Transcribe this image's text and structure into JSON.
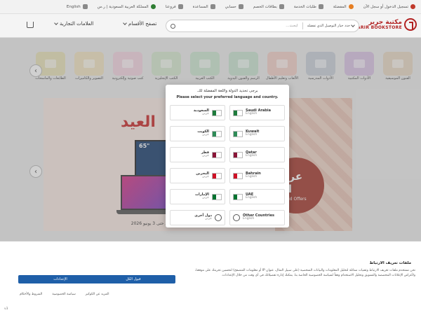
{
  "topbar": {
    "language": "English",
    "country": "المملكة العربية السعودية | ر.س",
    "wishlist": "المفضلة",
    "account": "تسجيل الدخول أو سجل الآن",
    "items": [
      "المفضلة",
      "طلبات الخدمة",
      "بطاقات الخصم",
      "حسابي",
      "المساعدة",
      "فروعنا"
    ]
  },
  "header": {
    "logo_ar": "مكتبة جرير",
    "logo_en": "JARIR BOOKSTORE",
    "search_location": "حدد خيار التوصيل الذي تفضله",
    "search_placeholder": "ابحث...",
    "browse_label": "تصفح الأقسام",
    "brands_label": "العلامات التجارية"
  },
  "categories": [
    {
      "label": "الفنون الموسيقية",
      "color": "#e9d9c5"
    },
    {
      "label": "الأدوات المكتبية",
      "color": "#d9c4e3"
    },
    {
      "label": "الأدوات المدرسية",
      "color": "#c9cfd9"
    },
    {
      "label": "الألعاب وتعليم الأطفال",
      "color": "#f2cfc8"
    },
    {
      "label": "الرسم والفنون اليدوية",
      "color": "#c9e3d1"
    },
    {
      "label": "الكتب العربية",
      "color": "#cde6d2"
    },
    {
      "label": "الكتب الإنجليزية",
      "color": "#d6e9cf"
    },
    {
      "label": "كتب صوتية وإلكترونية",
      "color": "#f3d4e0"
    },
    {
      "label": "التصوير والكاميرات",
      "color": "#f1e3c2"
    },
    {
      "label": "الطابعات والماسحات",
      "color": "#e8e2b8"
    }
  ],
  "banner": {
    "headline_ar": "العيد",
    "badge_ar": "عروض العيد",
    "badge_en": "Eid Offers",
    "tv_text": "65\"",
    "caption": "*يسري العرض على أصناف مختارة فقط *تسري العروض حتى 3 يونيو 2026"
  },
  "modal": {
    "title_ar": "برجى تحديد الدولة واللغة المفضلة لك.",
    "title_en": "Please select your preferred language and country.",
    "options": [
      {
        "name": "السعودية",
        "lang": "عربي",
        "dir": "rtl",
        "flag": "#1e7b3c"
      },
      {
        "name": "Saudi Arabia",
        "lang": "English",
        "dir": "ltr",
        "flag": "#1e7b3c"
      },
      {
        "name": "الكويت",
        "lang": "عربي",
        "dir": "rtl",
        "flag": "#2e8b57"
      },
      {
        "name": "Kuwait",
        "lang": "English",
        "dir": "ltr",
        "flag": "#2e8b57"
      },
      {
        "name": "قطر",
        "lang": "عربي",
        "dir": "rtl",
        "flag": "#8a1538"
      },
      {
        "name": "Qatar",
        "lang": "English",
        "dir": "ltr",
        "flag": "#8a1538"
      },
      {
        "name": "البحرين",
        "lang": "عربي",
        "dir": "rtl",
        "flag": "#ce1126"
      },
      {
        "name": "Bahrain",
        "lang": "English",
        "dir": "ltr",
        "flag": "#ce1126"
      },
      {
        "name": "الإمارات",
        "lang": "عربي",
        "dir": "rtl",
        "flag": "#00732f"
      },
      {
        "name": "UAE",
        "lang": "English",
        "dir": "ltr",
        "flag": "#00732f"
      },
      {
        "name": "دول أخرى",
        "lang": "عربي",
        "dir": "rtl",
        "flag": "globe"
      },
      {
        "name": "Other Countries",
        "lang": "English",
        "dir": "ltr",
        "flag": "globe"
      }
    ]
  },
  "cookie": {
    "title": "ملفات تعريف الارتباط",
    "body": "نحن نستخدم ملفات تعريف الارتباط وتقنيات مماثلة لتحليل المعلومات والبيانات الشخصية (على سبيل المثال، عنوان IP أو معلومات المتصفح) لتحسين تجربتك على موقعنا، ولأغراض الإعلانات المخصصة والتسويق وتحليل الاستخدام وفقاً لسياسة الخصوصية الخاصة بنا. يمكنك إدارة تفضيلاتك في أي وقت من خلال الإعدادات.",
    "accept_label": "قبول الكل",
    "settings_label": "الإعدادات",
    "links": [
      "المزيد عن الكوكيز",
      "سياسة الخصوصية",
      "الشروط والأحكام"
    ],
    "footer": "v3"
  }
}
